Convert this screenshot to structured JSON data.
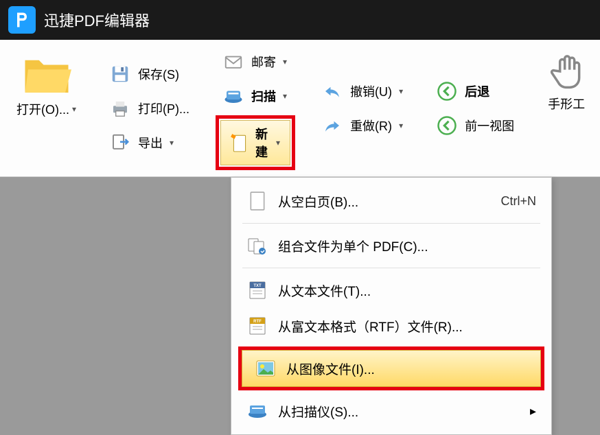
{
  "app": {
    "title": "迅捷PDF编辑器"
  },
  "toolbar": {
    "open": "打开(O)...",
    "save": "保存(S)",
    "print": "打印(P)...",
    "export": "导出",
    "mail": "邮寄",
    "scan": "扫描",
    "new": "新建",
    "undo": "撤销(U)",
    "redo": "重做(R)",
    "back": "后退",
    "prevview": "前一视图",
    "hand": "手形工"
  },
  "menu": {
    "blank": "从空白页(B)...",
    "blank_shortcut": "Ctrl+N",
    "combine": "组合文件为单个 PDF(C)...",
    "fromtext": "从文本文件(T)...",
    "fromrtf": "从富文本格式（RTF）文件(R)...",
    "fromimage": "从图像文件(I)...",
    "fromscanner": "从扫描仪(S)..."
  },
  "colors": {
    "accent": "#1e9fff",
    "highlight": "#e60012",
    "hover_grad": "#ffe89a"
  }
}
